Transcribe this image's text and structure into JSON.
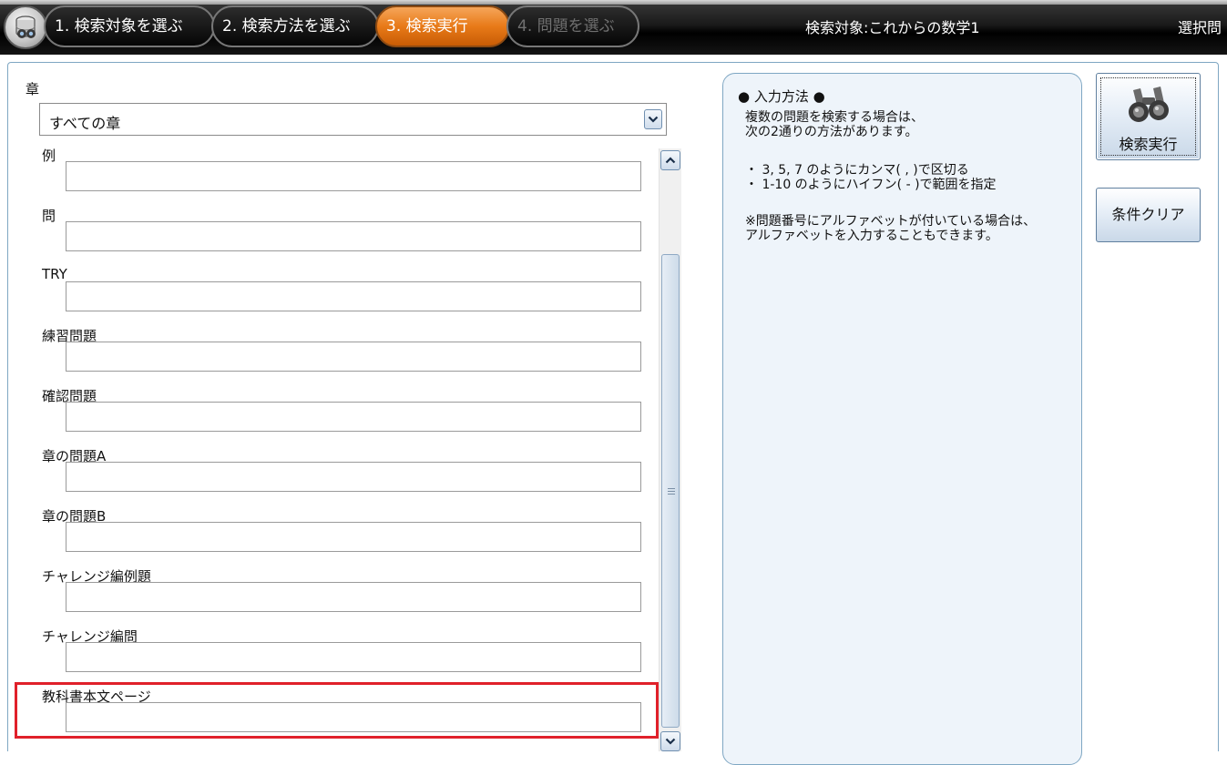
{
  "header": {
    "steps": [
      {
        "label": "1. 検索対象を選ぶ"
      },
      {
        "label": "2. 検索方法を選ぶ"
      },
      {
        "label": "3. 検索実行"
      },
      {
        "label": "4. 問題を選ぶ"
      }
    ],
    "target_label": "検索対象:これからの数学1",
    "select_label": "選択問",
    "home_icon": "database-search-icon"
  },
  "form": {
    "chapter_label": "章",
    "chapter_value": "すべての章",
    "fields": [
      {
        "label": "例",
        "value": ""
      },
      {
        "label": "問",
        "value": ""
      },
      {
        "label": "TRY",
        "value": ""
      },
      {
        "label": "練習問題",
        "value": ""
      },
      {
        "label": "確認問題",
        "value": ""
      },
      {
        "label": "章の問題A",
        "value": ""
      },
      {
        "label": "章の問題B",
        "value": ""
      },
      {
        "label": "チャレンジ編例題",
        "value": ""
      },
      {
        "label": "チャレンジ編問",
        "value": ""
      },
      {
        "label": "教科書本文ページ",
        "value": ""
      }
    ],
    "highlight_color": "#e0202a"
  },
  "help": {
    "title": "● 入力方法 ●",
    "lines": [
      "複数の問題を検索する場合は、",
      "次の2通りの方法があります。",
      "・ 3, 5, 7 のようにカンマ( , )で区切る",
      "・ 1-10 のようにハイフン( - )で範囲を指定",
      "※問題番号にアルファベットが付いている場合は、",
      "アルファベットを入力することもできます。"
    ]
  },
  "buttons": {
    "search_label": "検索実行",
    "clear_label": "条件クリア"
  },
  "colors": {
    "active_step": "#e87a18",
    "panel_border": "#7fa7c3",
    "help_bg": "#eef4fa"
  }
}
